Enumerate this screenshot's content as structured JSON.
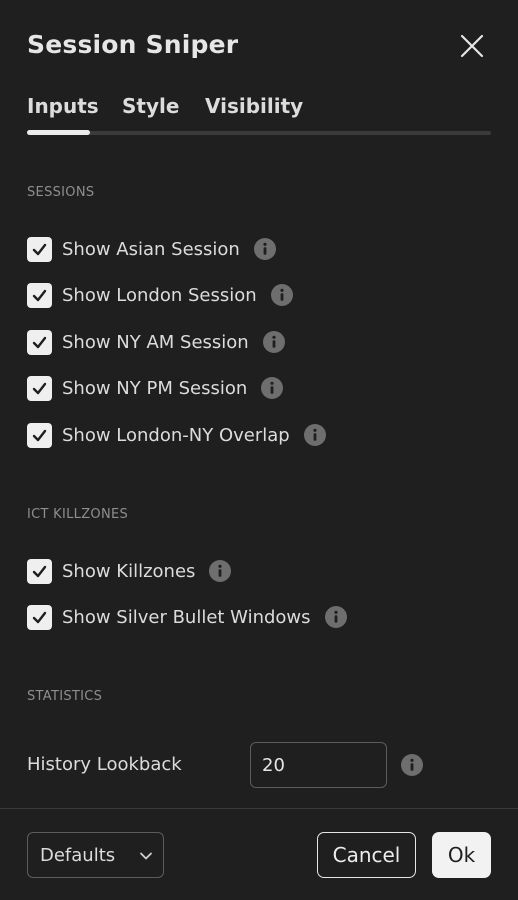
{
  "dialog": {
    "title": "Session Sniper"
  },
  "tabs": [
    {
      "label": "Inputs",
      "active": true
    },
    {
      "label": "Style",
      "active": false
    },
    {
      "label": "Visibility",
      "active": false
    }
  ],
  "sections": {
    "sessions": {
      "label": "SESSIONS",
      "items": [
        {
          "label": "Show Asian Session",
          "checked": true
        },
        {
          "label": "Show London Session",
          "checked": true
        },
        {
          "label": "Show NY AM Session",
          "checked": true
        },
        {
          "label": "Show NY PM Session",
          "checked": true
        },
        {
          "label": "Show London-NY Overlap",
          "checked": true
        }
      ]
    },
    "killzones": {
      "label": "ICT KILLZONES",
      "items": [
        {
          "label": "Show Killzones",
          "checked": true
        },
        {
          "label": "Show Silver Bullet Windows",
          "checked": true
        }
      ]
    },
    "statistics": {
      "label": "STATISTICS",
      "history_lookback": {
        "label": "History Lookback",
        "value": "20"
      }
    }
  },
  "footer": {
    "defaults_label": "Defaults",
    "cancel_label": "Cancel",
    "ok_label": "Ok"
  },
  "icons": {
    "close": "close-icon",
    "check": "checkmark-icon",
    "info": "info-icon",
    "chevron": "chevron-down-icon"
  },
  "colors": {
    "background": "#1f1f1f",
    "text": "#dcdcdc",
    "muted": "#8e8e8e",
    "checkbox": "#efefef",
    "info_icon": "#6e6e6e",
    "ok_button": "#f2f2f2"
  }
}
